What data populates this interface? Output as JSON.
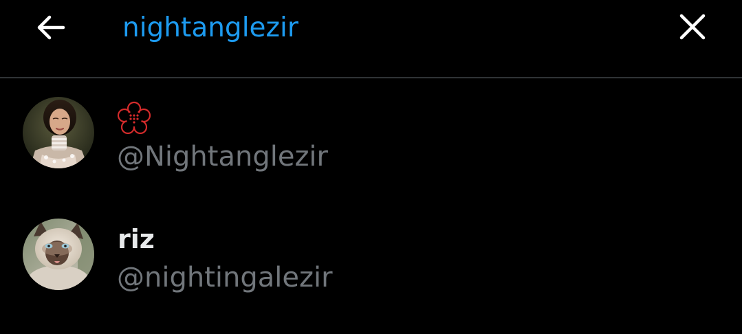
{
  "header": {
    "back_icon": "arrow-left-icon",
    "close_icon": "close-icon",
    "search_value": "nightanglezir",
    "accent_color": "#1d9bf0"
  },
  "results": [
    {
      "display_name": "",
      "badge_icon": "red-flower-emblem-icon",
      "handle": "@Nightanglezir",
      "avatar": "woman-portrait-avatar"
    },
    {
      "display_name": "riz",
      "handle": "@nightingalezir",
      "avatar": "siamese-cat-avatar"
    }
  ]
}
